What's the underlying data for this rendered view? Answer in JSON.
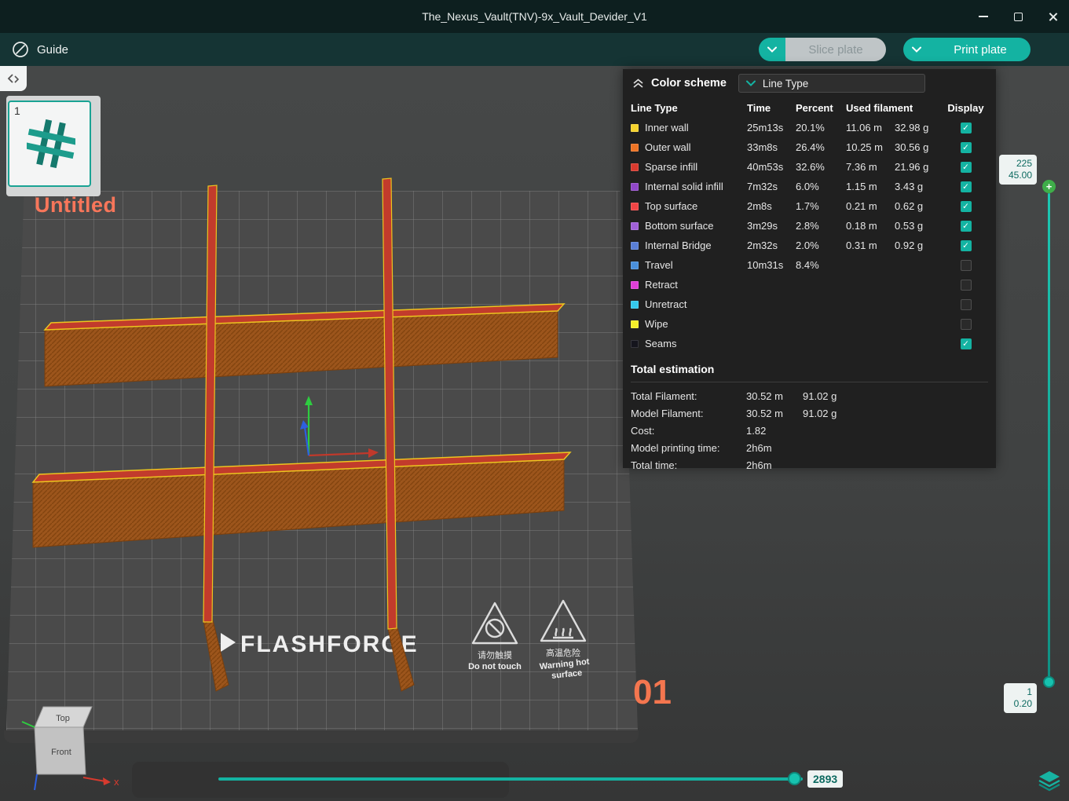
{
  "window": {
    "title": "The_Nexus_Vault(TNV)-9x_Vault_Devider_V1"
  },
  "toolbar": {
    "guide": "Guide",
    "slice_plate": "Slice plate",
    "print_plate": "Print plate"
  },
  "scene": {
    "plate_thumb_index": "1",
    "project_name": "Untitled",
    "brand": "FLASHFORGE",
    "plate_number": "01",
    "warning_touch_cn": "请勿触摸",
    "warning_touch_en": "Do not touch",
    "warning_hot_cn": "高温危险",
    "warning_hot_en1": "Warning hot",
    "warning_hot_en2": "surface",
    "viewcube_top": "Top",
    "viewcube_front": "Front",
    "axis_x_label": "x"
  },
  "panel": {
    "title": "Color scheme",
    "scheme": "Line Type",
    "columns": {
      "line_type": "Line Type",
      "time": "Time",
      "percent": "Percent",
      "used_filament": "Used filament",
      "display": "Display"
    },
    "rows": [
      {
        "color": "#f6d32d",
        "label": "Inner wall",
        "time": "25m13s",
        "percent": "20.1%",
        "length": "11.06 m",
        "weight": "32.98 g",
        "display": true
      },
      {
        "color": "#ee7425",
        "label": "Outer wall",
        "time": "33m8s",
        "percent": "26.4%",
        "length": "10.25 m",
        "weight": "30.56 g",
        "display": true
      },
      {
        "color": "#d93a2e",
        "label": "Sparse infill",
        "time": "40m53s",
        "percent": "32.6%",
        "length": "7.36 m",
        "weight": "21.96 g",
        "display": true
      },
      {
        "color": "#9047c8",
        "label": "Internal solid infill",
        "time": "7m32s",
        "percent": "6.0%",
        "length": "1.15 m",
        "weight": "3.43 g",
        "display": true
      },
      {
        "color": "#f04545",
        "label": "Top surface",
        "time": "2m8s",
        "percent": "1.7%",
        "length": "0.21 m",
        "weight": "0.62 g",
        "display": true
      },
      {
        "color": "#a060d8",
        "label": "Bottom surface",
        "time": "3m29s",
        "percent": "2.8%",
        "length": "0.18 m",
        "weight": "0.53 g",
        "display": true
      },
      {
        "color": "#5a7fd6",
        "label": "Internal Bridge",
        "time": "2m32s",
        "percent": "2.0%",
        "length": "0.31 m",
        "weight": "0.92 g",
        "display": true
      },
      {
        "color": "#4a90dc",
        "label": "Travel",
        "time": "10m31s",
        "percent": "8.4%",
        "length": "",
        "weight": "",
        "display": false
      },
      {
        "color": "#e03fd8",
        "label": "Retract",
        "time": "",
        "percent": "",
        "length": "",
        "weight": "",
        "display": false
      },
      {
        "color": "#35c8ec",
        "label": "Unretract",
        "time": "",
        "percent": "",
        "length": "",
        "weight": "",
        "display": false
      },
      {
        "color": "#f3ee2a",
        "label": "Wipe",
        "time": "",
        "percent": "",
        "length": "",
        "weight": "",
        "display": false
      },
      {
        "color": "#15151d",
        "label": "Seams",
        "time": "",
        "percent": "",
        "length": "",
        "weight": "",
        "display": true
      }
    ],
    "total": {
      "header": "Total estimation",
      "rows": [
        {
          "label": "Total Filament:",
          "a": "30.52 m",
          "b": "91.02 g"
        },
        {
          "label": "Model Filament:",
          "a": "30.52 m",
          "b": "91.02 g"
        },
        {
          "label": "Cost:",
          "a": "1.82",
          "b": ""
        },
        {
          "label": "Model printing time:",
          "a": "2h6m",
          "b": ""
        },
        {
          "label": "Total time:",
          "a": "2h6m",
          "b": ""
        }
      ]
    }
  },
  "sliders": {
    "layer_max": "225",
    "height_max": "45.00",
    "layer_min": "1",
    "height_min": "0.20",
    "step": "2893",
    "plus": "+"
  },
  "colors": {
    "accent": "#14b3a2"
  }
}
